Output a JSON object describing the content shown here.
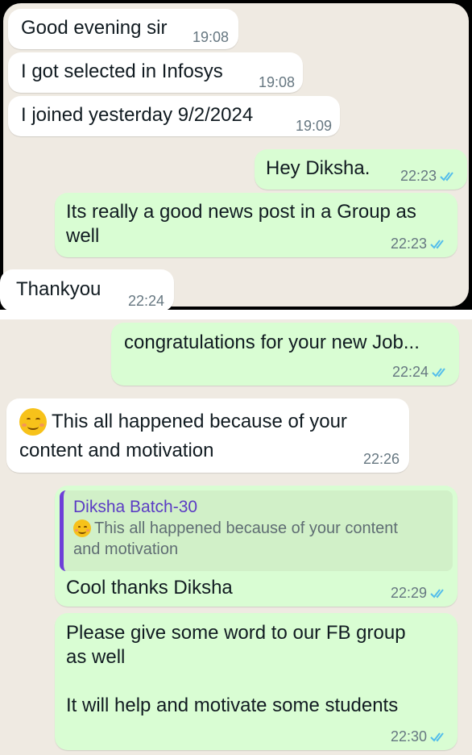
{
  "messages_top": [
    {
      "text": "Good evening sir",
      "time": "19:08",
      "dir": "in"
    },
    {
      "text": "I got selected in Infosys",
      "time": "19:08",
      "dir": "in"
    },
    {
      "text": "I joined yesterday 9/2/2024",
      "time": "19:09",
      "dir": "in"
    },
    {
      "text": "Hey Diksha.",
      "time": "22:23",
      "dir": "out"
    },
    {
      "text": "Its really a good news post in a Group as\nwell",
      "time": "22:23",
      "dir": "out"
    },
    {
      "text": "Thankyou",
      "time": "22:24",
      "dir": "in"
    }
  ],
  "messages_bottom": [
    {
      "text": "congratulations for your new Job...",
      "time": "22:24",
      "dir": "out"
    },
    {
      "text_line1": "This all happened because of your",
      "text_line2": "content and motivation",
      "emoji": "smiling-face-icon",
      "time": "22:26",
      "dir": "in"
    },
    {
      "quote_author": "Diksha Batch-30",
      "quote_line1": "This all happened because of your content",
      "quote_line2": "and motivation",
      "quote_emoji": "smiling-face-icon",
      "text": "Cool thanks Diksha",
      "time": "22:29",
      "dir": "out"
    },
    {
      "text": "Please give some word to our FB group\nas well\n\nIt will help and motivate some students",
      "time": "22:30",
      "dir": "out"
    }
  ],
  "colors": {
    "incoming": "#ffffff",
    "outgoing": "#d9fdd3",
    "tick": "#53bdeb",
    "quote_bar": "#6e3fd8",
    "quote_name": "#5b3cc4",
    "chat_bg": "#efeae2"
  },
  "icons": {
    "read_receipt": "double-check-icon"
  }
}
